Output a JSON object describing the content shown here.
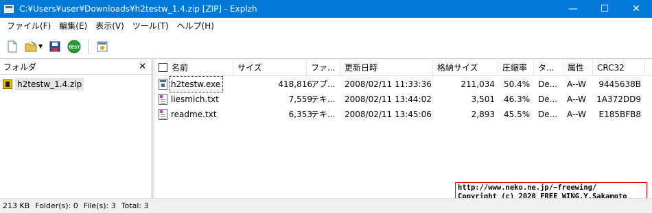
{
  "window": {
    "title": "C:¥Users¥user¥Downloads¥h2testw_1.4.zip [ZIP] - Explzh",
    "buttons": {
      "minimize": "—",
      "maximize": "☐",
      "close": "✕"
    }
  },
  "menu": {
    "items": [
      {
        "label": "ファイル(F)"
      },
      {
        "label": "編集(E)"
      },
      {
        "label": "表示(V)"
      },
      {
        "label": "ツール(T)"
      },
      {
        "label": "ヘルプ(H)"
      }
    ]
  },
  "toolbar": {
    "buttons": [
      {
        "name": "new-archive-icon"
      },
      {
        "name": "open-folder-icon"
      },
      {
        "name": "save-icon"
      },
      {
        "name": "test-icon",
        "text": "TEST"
      },
      {
        "name": "extract-icon"
      }
    ]
  },
  "folder_pane": {
    "header": "フォルダ",
    "close_glyph": "✕",
    "item": "h2testw_1.4.zip"
  },
  "list": {
    "columns": [
      "名前",
      "サイズ",
      "ファ...",
      "更新日時",
      "格納サイズ",
      "圧縮率",
      "タ...",
      "属性",
      "CRC32"
    ],
    "rows": [
      {
        "name": "h2testw.exe",
        "size": "418,816",
        "type": "アプ...",
        "modified": "2008/02/11 11:33:36",
        "packed": "211,034",
        "ratio": "50.4%",
        "method": "De...",
        "attr": "A--W",
        "crc": "9445638B",
        "icon": "exe"
      },
      {
        "name": "liesmich.txt",
        "size": "7,559",
        "type": "テキ...",
        "modified": "2008/02/11 13:44:02",
        "packed": "3,501",
        "ratio": "46.3%",
        "method": "De...",
        "attr": "A--W",
        "crc": "1A372DD9",
        "icon": "txt"
      },
      {
        "name": "readme.txt",
        "size": "6,353",
        "type": "テキ...",
        "modified": "2008/02/11 13:45:06",
        "packed": "2,893",
        "ratio": "45.5%",
        "method": "De...",
        "attr": "A--W",
        "crc": "E185BFB8",
        "icon": "txt"
      }
    ]
  },
  "copyright": {
    "line1": "http://www.neko.ne.jp/~freewing/",
    "line2": "Copyright (c) 2020 FREE WING,Y.Sakamoto"
  },
  "status": {
    "size": "213 KB",
    "folders": "Folder(s): 0",
    "files": "File(s): 3",
    "total": "Total: 3"
  },
  "colors": {
    "titlebar": "#0078d7",
    "copyright_border": "#e00000"
  }
}
